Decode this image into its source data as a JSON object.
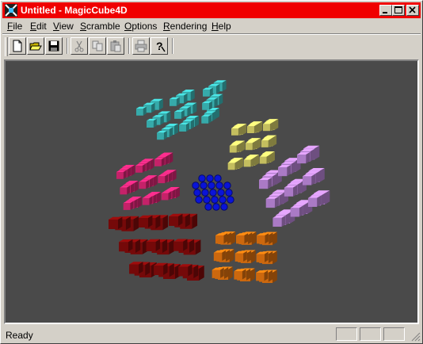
{
  "window": {
    "title": "Untitled - MagicCube4D"
  },
  "menubar": {
    "items": [
      {
        "key": "F",
        "rest": "ile"
      },
      {
        "key": "E",
        "rest": "dit"
      },
      {
        "key": "V",
        "rest": "iew"
      },
      {
        "key": "S",
        "rest": "cramble"
      },
      {
        "key": "O",
        "rest": "ptions"
      },
      {
        "key": "R",
        "rest": "endering"
      },
      {
        "key": "H",
        "rest": "elp"
      }
    ]
  },
  "toolbar": {
    "buttons": [
      "new-file-icon",
      "open-folder-icon",
      "save-disk-icon",
      "cut-scissors-icon",
      "copy-icon",
      "paste-clipboard-icon",
      "print-icon",
      "help-question-icon"
    ]
  },
  "viewport": {
    "background": "#4a4a4a",
    "faces": {
      "cyan": "#40c8c8",
      "yellow": "#e6e070",
      "lavender": "#c890e8",
      "magenta": "#e8287c",
      "blue": "#0a14d8",
      "dark_red": "#8a0a0a",
      "orange": "#f07a10"
    }
  },
  "statusbar": {
    "text": "Ready"
  }
}
